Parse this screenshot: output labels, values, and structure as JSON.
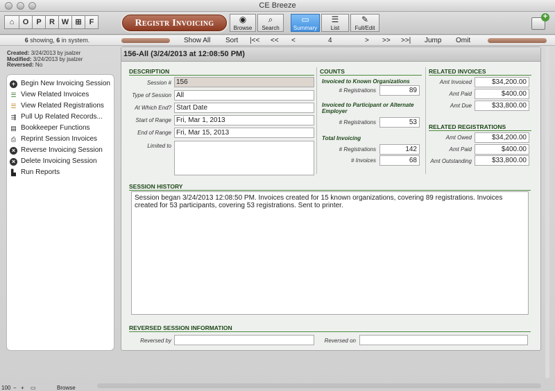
{
  "window": {
    "title": "CE Breeze"
  },
  "toolbar": {
    "nav_letters": [
      "O",
      "P",
      "R",
      "W",
      "⊞",
      "F"
    ],
    "layout_button": "Registr Invoicing",
    "buttons": [
      {
        "label": "Browse",
        "icon": "eye-icon"
      },
      {
        "label": "Search",
        "icon": "magnifier-icon"
      },
      {
        "label": "Summary",
        "icon": "summary-icon",
        "active": true
      },
      {
        "label": "List",
        "icon": "list-icon"
      },
      {
        "label": "Full/Edit",
        "icon": "edit-icon"
      }
    ]
  },
  "statusbar": {
    "showing": "6",
    "showing_text": " showing, ",
    "total": "6",
    "total_text": " in system.",
    "show_all": "Show All",
    "sort": "Sort",
    "first": "|<<",
    "prev_page": "<<",
    "prev": "<",
    "record": "4",
    "next": ">",
    "next_page": ">>",
    "last": ">>|",
    "jump": "Jump",
    "omit": "Omit"
  },
  "meta": {
    "created_label": "Created:",
    "created": "3/24/2013 by jsalzer",
    "modified_label": "Modified:",
    "modified": "3/24/2013 by jsalzer",
    "reversed_label": "Reversed:",
    "reversed": "No"
  },
  "actions": [
    {
      "label": "Begin New Invoicing Session",
      "icon": "plus-circle-icon"
    },
    {
      "label": "View Related Invoices",
      "icon": "list-green-icon"
    },
    {
      "label": "View Related Registrations",
      "icon": "list-orange-icon"
    },
    {
      "label": "Pull Up Related Records...",
      "icon": "link-icon"
    },
    {
      "label": "Bookkeeper Functions",
      "icon": "ledger-icon"
    },
    {
      "label": "Reprint Session Invoices",
      "icon": "printer-icon"
    },
    {
      "label": "Reverse Invoicing Session",
      "icon": "close-circle-icon"
    },
    {
      "label": "Delete Invoicing Session",
      "icon": "close-circle-icon"
    },
    {
      "label": "Run Reports",
      "icon": "bar-chart-icon"
    }
  ],
  "record": {
    "header": "156-All  (3/24/2013 at 12:08:50 PM)"
  },
  "description": {
    "heading": "DESCRIPTION",
    "session_label": "Session #",
    "session": "156",
    "type_label": "Type of Session",
    "type": "All",
    "at_which_end_label": "At Which End?",
    "at_which_end": "Start Date",
    "start_label": "Start of Range",
    "start": "Fri, Mar 1, 2013",
    "end_label": "End of Range",
    "end": "Fri, Mar 15, 2013",
    "limited_label": "Limited to",
    "limited": ""
  },
  "counts": {
    "heading": "COUNTS",
    "known_heading": "Invoiced to Known Organizations",
    "known_reg_label": "# Registrations",
    "known_reg": "89",
    "participant_heading": "Invoiced to Participant or Alternate Employer",
    "participant_reg_label": "# Registrations",
    "participant_reg": "53",
    "total_heading": "Total Invoicing",
    "total_reg_label": "# Registrations",
    "total_reg": "142",
    "total_inv_label": "# Invoices",
    "total_inv": "68"
  },
  "related_invoices": {
    "heading": "RELATED INVOICES",
    "invoiced_label": "Amt Invoiced",
    "invoiced": "$34,200.00",
    "paid_label": "Amt Paid",
    "paid": "$400.00",
    "due_label": "Amt Due",
    "due": "$33,800.00"
  },
  "related_registrations": {
    "heading": "RELATED REGISTRATIONS",
    "owed_label": "Amt Owed",
    "owed": "$34,200.00",
    "paid_label": "Amt Paid",
    "paid": "$400.00",
    "outstanding_label": "Amt Outstanding",
    "outstanding": "$33,800.00"
  },
  "history": {
    "heading": "SESSION HISTORY",
    "text": "Session began 3/24/2013 12:08:50 PM.  Invoices created for 15 known organizations, covering 89 registrations.  Invoices created for 53 participants, covering 53 registrations.  Sent to printer."
  },
  "reversed": {
    "heading": "REVERSED SESSION INFORMATION",
    "by_label": "Reversed by",
    "by": "",
    "on_label": "Reversed on",
    "on": ""
  },
  "bottom": {
    "zoom": "100",
    "mode": "Browse"
  }
}
